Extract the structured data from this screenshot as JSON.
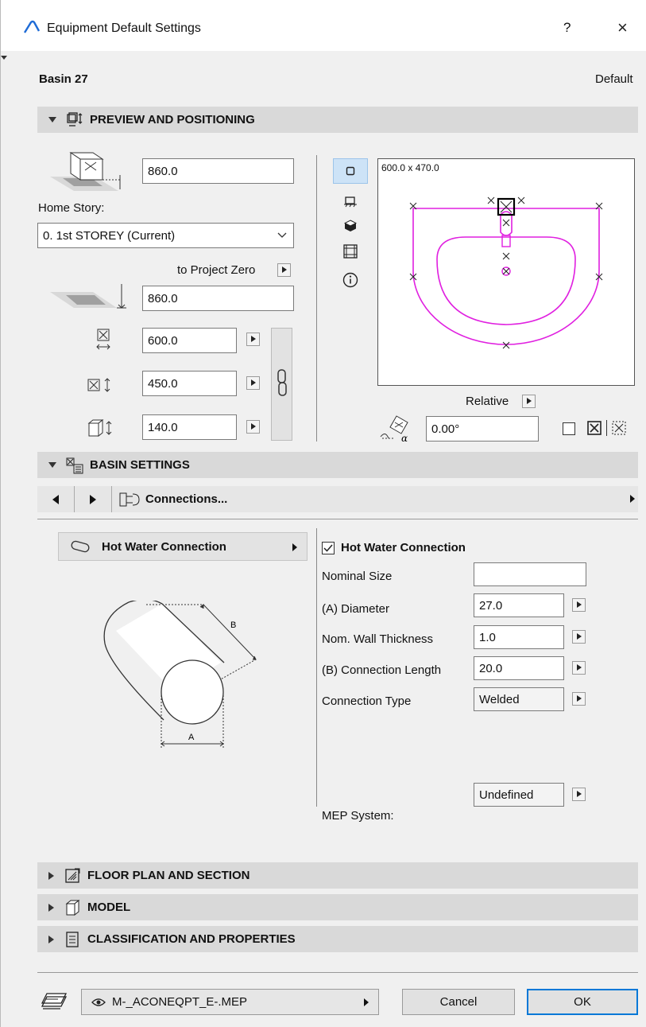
{
  "window": {
    "title": "Equipment Default Settings",
    "help": "?",
    "close": "×"
  },
  "element": {
    "name": "Basin 27",
    "default_label": "Default"
  },
  "sections": {
    "preview": "PREVIEW AND POSITIONING",
    "basin": "BASIN SETTINGS",
    "floor": "FLOOR PLAN AND SECTION",
    "model": "MODEL",
    "classification": "CLASSIFICATION AND PROPERTIES"
  },
  "positioning": {
    "elevation_to_story": "860.0",
    "home_story_label": "Home Story:",
    "home_story_value": "0. 1st STOREY (Current)",
    "to_project_zero": "to Project Zero",
    "elevation_to_zero": "860.0",
    "width": "600.0",
    "depth": "450.0",
    "height": "140.0"
  },
  "preview_panel": {
    "dimensions": "600.0 x 470.0",
    "relative_label": "Relative",
    "rotation": "0.00°"
  },
  "nav": {
    "panel_name": "Connections..."
  },
  "connection": {
    "list_item": "Hot Water Connection",
    "checkbox_label": "Hot Water Connection",
    "checked": true,
    "diagram_a": "A",
    "diagram_b": "B",
    "params": [
      {
        "label": "Nominal Size",
        "value": ""
      },
      {
        "label": "(A) Diameter",
        "value": "27.0"
      },
      {
        "label": "Nom. Wall Thickness",
        "value": "1.0"
      },
      {
        "label": "(B) Connection Length",
        "value": "20.0"
      },
      {
        "label": "Connection Type",
        "value": "Welded"
      }
    ],
    "mep_label": "MEP System:",
    "mep_value": "Undefined"
  },
  "footer": {
    "layer": "M-_ACONEQPT_E-.MEP",
    "cancel": "Cancel",
    "ok": "OK"
  },
  "colors": {
    "accent": "#0078d7",
    "preview_line": "#e020e0",
    "header_bg": "#d9d9d9"
  }
}
